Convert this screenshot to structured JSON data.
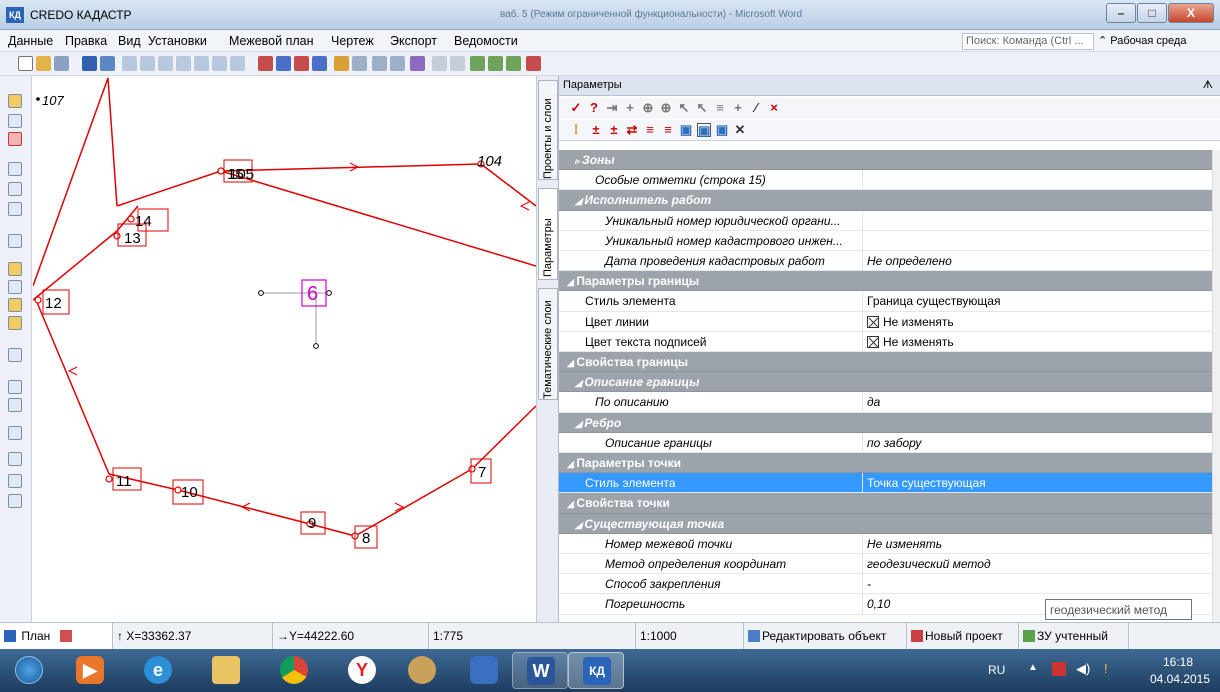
{
  "window": {
    "app_title": "CREDO КАДАСТР",
    "background_doc": "ваб. 5 (Режим ограниченной функциональности) - Microsoft Word",
    "minimize": "–",
    "maximize": "□",
    "close": "X"
  },
  "menu": {
    "items": [
      "Данные",
      "Правка",
      "Вид",
      "Установки",
      "Межевой план",
      "Чертеж",
      "Экспорт",
      "Ведомости"
    ],
    "search_placeholder": "Поиск: Команда (Ctrl ...",
    "workspace_label": "Рабочая среда"
  },
  "canvas": {
    "scale_label": "107",
    "points": [
      "15",
      "105",
      "104",
      "14",
      "13",
      "12",
      "6",
      "11",
      "10",
      "9",
      "8",
      "7"
    ],
    "line_color": "#e00000",
    "marker_color": "#d000d0"
  },
  "side_tabs": [
    "Проекты и слои",
    "Параметры",
    "Тематические слои"
  ],
  "panel": {
    "title": "Параметры",
    "pin": "ᗑ",
    "rows": [
      {
        "label": "Зоны",
        "value": "",
        "type": "header",
        "level": 1
      },
      {
        "label": "Особые отметки (строка 15)",
        "value": "",
        "type": "prop",
        "level": 1
      },
      {
        "label": "Исполнитель работ",
        "value": "",
        "type": "header",
        "level": 1
      },
      {
        "label": "Уникальный номер юридической органи...",
        "value": "",
        "type": "prop",
        "level": 2
      },
      {
        "label": "Уникальный номер кадастрового инжен...",
        "value": "",
        "type": "prop",
        "level": 2
      },
      {
        "label": "Дата проведения кадастровых работ",
        "value": "Не определено",
        "type": "prop",
        "level": 2
      },
      {
        "label": "Параметры границы",
        "value": "",
        "type": "header",
        "level": 0
      },
      {
        "label": "Стиль элемента",
        "value": "Граница существующая",
        "type": "plain",
        "level": 0
      },
      {
        "label": "Цвет линии",
        "value": "Не изменять",
        "type": "plain",
        "level": 0,
        "check": true
      },
      {
        "label": "Цвет текста подписей",
        "value": "Не изменять",
        "type": "plain",
        "level": 0,
        "check": true
      },
      {
        "label": "Свойства границы",
        "value": "",
        "type": "header",
        "level": 0
      },
      {
        "label": "Описание границы",
        "value": "",
        "type": "header",
        "level": 1
      },
      {
        "label": "По описанию",
        "value": "да",
        "type": "prop",
        "level": 1
      },
      {
        "label": "Ребро",
        "value": "",
        "type": "header",
        "level": 1
      },
      {
        "label": "Описание границы",
        "value": "по забору",
        "type": "prop",
        "level": 2
      },
      {
        "label": "Параметры точки",
        "value": "",
        "type": "header",
        "level": 0
      },
      {
        "label": "Стиль элемента",
        "value": "Точка существующая",
        "type": "selected",
        "level": 0
      },
      {
        "label": "Свойства точки",
        "value": "",
        "type": "header",
        "level": 0
      },
      {
        "label": "Существующая точка",
        "value": "",
        "type": "header",
        "level": 1
      },
      {
        "label": "Номер межевой точки",
        "value": "Не изменять",
        "type": "prop",
        "level": 2
      },
      {
        "label": "Метод определения координат",
        "value": "геодезический метод",
        "type": "prop",
        "level": 2
      },
      {
        "label": "Способ закрепления",
        "value": "-",
        "type": "prop",
        "level": 2
      },
      {
        "label": "Погрешность",
        "value": "0,10",
        "type": "prop",
        "level": 2
      }
    ],
    "tooltip": "геодезический метод"
  },
  "status": {
    "tab_label": "План",
    "x_coord": "X=33362.37",
    "y_coord": "Y=44222.60",
    "ratio": "1:775",
    "scale": "1:1000",
    "edit_object": "Редактировать объект",
    "new_project": "Новый проект",
    "registered": "ЗУ учтенный"
  },
  "taskbar": {
    "lang": "RU",
    "time": "16:18",
    "date": "04.04.2015"
  }
}
